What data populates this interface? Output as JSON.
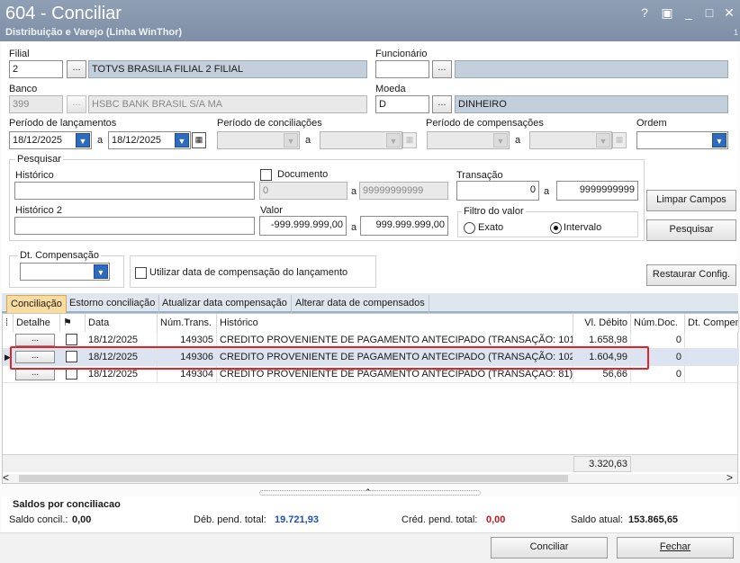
{
  "window": {
    "title": "604 - Conciliar",
    "subtitle": "Distribuição e Varejo (Linha WinThor)",
    "controls": {
      "help": "?",
      "restore": "▣",
      "minimize": "_",
      "maximize": "□",
      "close": "✕"
    },
    "corner_mark": "1"
  },
  "filial": {
    "label": "Filial",
    "code": "2",
    "button": "...",
    "name": "TOTVS BRASILIA FILIAL 2 FILIAL"
  },
  "funcionario": {
    "label": "Funcionário",
    "code": "",
    "button": "...",
    "name": ""
  },
  "banco": {
    "label": "Banco",
    "code": "399",
    "button": "...",
    "name": "HSBC BANK BRASIL S/A MA"
  },
  "moeda": {
    "label": "Moeda",
    "code": "D",
    "button": "...",
    "name": "DINHEIRO"
  },
  "periodo_lancamentos": {
    "label": "Período de lançamentos",
    "from": "18/12/2025",
    "separator": "a",
    "to": "18/12/2025"
  },
  "periodo_conciliacoes": {
    "label": "Período de conciliações",
    "from": "",
    "separator": "a",
    "to": ""
  },
  "periodo_compensacoes": {
    "label": "Período de compensações",
    "from": "",
    "separator": "a",
    "to": ""
  },
  "ordem": {
    "label": "Ordem",
    "value": ""
  },
  "pesquisar": {
    "legend": "Pesquisar",
    "historico": {
      "label": "Histórico",
      "value": ""
    },
    "documento": {
      "label": "Documento",
      "from": "0",
      "separator": "a",
      "to": "99999999999"
    },
    "transacao": {
      "label": "Transação",
      "from": "0",
      "separator": "a",
      "to": "9999999999"
    },
    "historico2": {
      "label": "Histórico 2",
      "value": ""
    },
    "valor": {
      "label": "Valor",
      "from": "-999.999.999,00",
      "separator": "a",
      "to": "999.999.999,00"
    },
    "filtro_valor": {
      "legend": "Filtro do valor",
      "exato": "Exato",
      "intervalo": "Intervalo",
      "selected": "intervalo"
    }
  },
  "buttons": {
    "limpar_campos": "Limpar Campos",
    "pesquisar": "Pesquisar",
    "restaurar_config": "Restaurar Config.",
    "conciliar": "Conciliar",
    "fechar": "Fechar"
  },
  "dt_compensacao": {
    "label": "Dt. Compensação",
    "value": ""
  },
  "utilizar_data": {
    "label": "Utilizar data de compensação do lançamento",
    "checked": false
  },
  "tabs": [
    {
      "label": "Conciliação",
      "active": true
    },
    {
      "label": "Estorno conciliação",
      "active": false
    },
    {
      "label": "Atualizar data compensação",
      "active": false
    },
    {
      "label": "Alterar data de compensados",
      "active": false
    }
  ],
  "grid": {
    "columns": {
      "detalhe": "Detalhe",
      "data": "Data",
      "num_trans": "Núm.Trans.",
      "historico": "Histórico",
      "vl_debito": "Vl. Débito",
      "num_doc": "Núm.Doc.",
      "dt_compen": "Dt. Compen"
    },
    "detail_button": "...",
    "rows": [
      {
        "data": "18/12/2025",
        "num_trans": "149305",
        "historico": "CREDITO PROVENIENTE DE PAGAMENTO ANTECIPADO (TRANSAÇÃO: 101)",
        "vl_debito": "1.658,98",
        "num_doc": "0"
      },
      {
        "data": "18/12/2025",
        "num_trans": "149306",
        "historico": "CREDITO PROVENIENTE DE PAGAMENTO ANTECIPADO (TRANSAÇÃO: 102)",
        "vl_debito": "1.604,99",
        "num_doc": "0"
      },
      {
        "data": "18/12/2025",
        "num_trans": "149304",
        "historico": "CREDITO PROVENIENTE DE PAGAMENTO ANTECIPADO (TRANSAÇÃO: 81)",
        "vl_debito": "56,66",
        "num_doc": "0"
      }
    ],
    "total_debito": "3.320,63",
    "scroll_left": "<",
    "scroll_right": ">"
  },
  "saldos": {
    "title": "Saldos por conciliacao",
    "saldo_concil_label": "Saldo concil.:",
    "saldo_concil_value": "0,00",
    "deb_pend_label": "Déb. pend. total:",
    "deb_pend_value": "19.721,93",
    "cred_pend_label": "Créd. pend. total:",
    "cred_pend_value": "0,00",
    "saldo_atual_label": "Saldo atual:",
    "saldo_atual_value": "153.865,65",
    "colors": {
      "debit": "#1f4fc4",
      "credit": "#c0161b"
    }
  }
}
